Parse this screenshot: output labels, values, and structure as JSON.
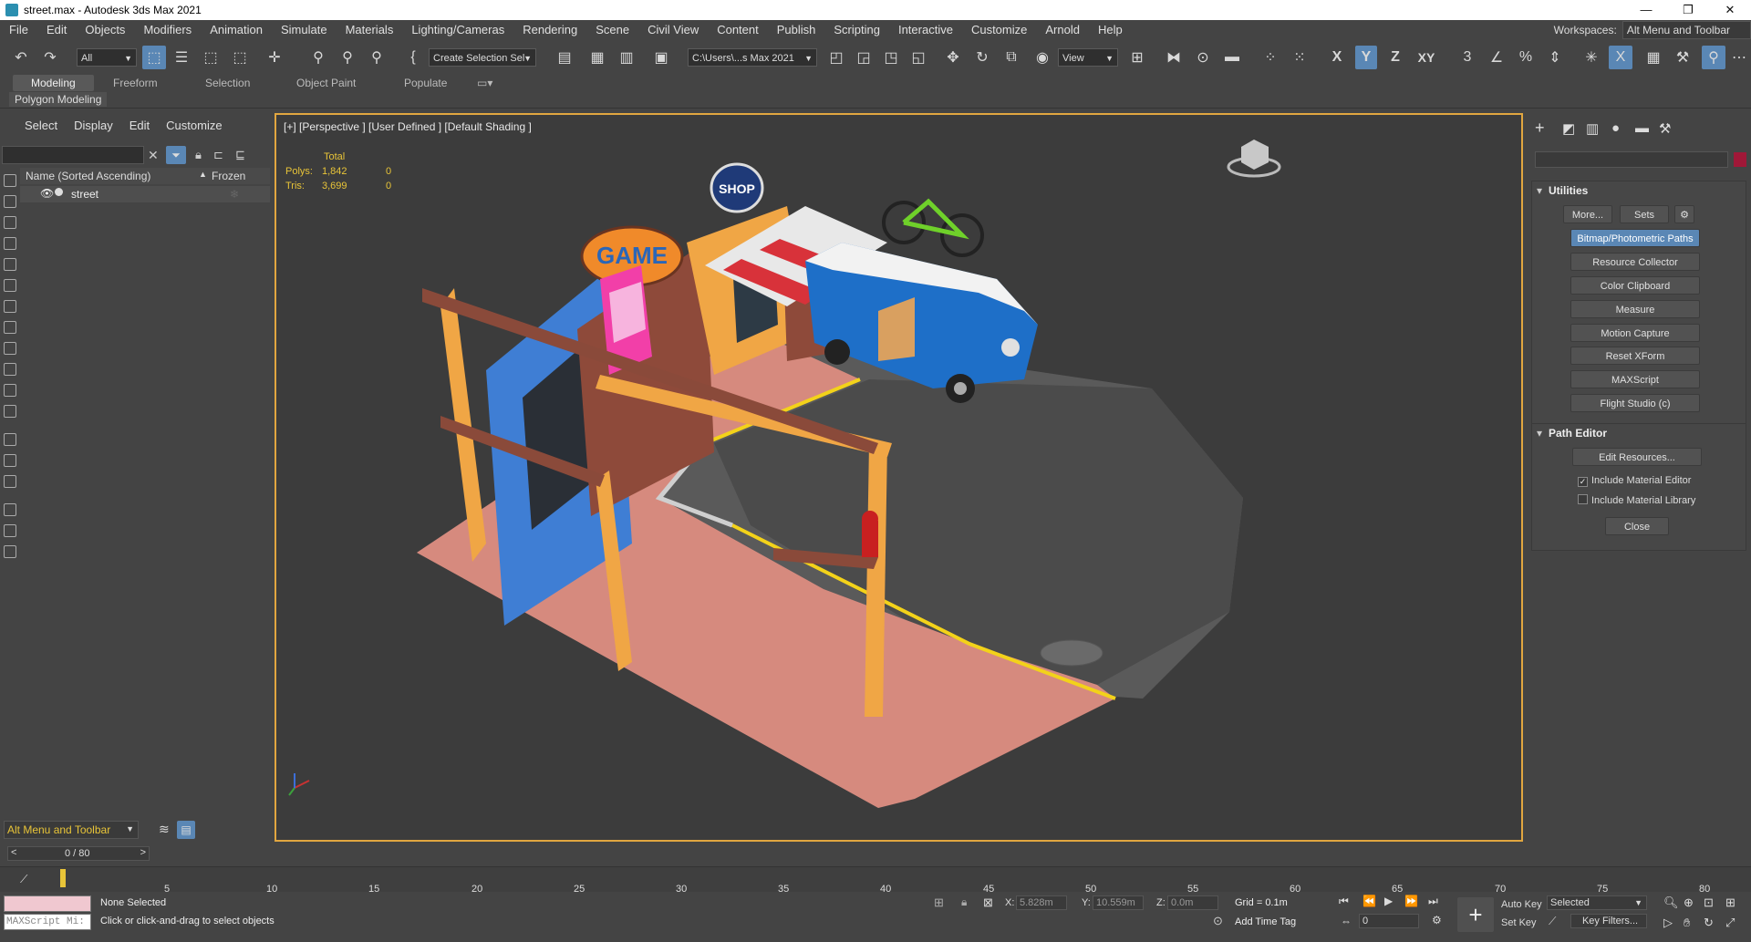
{
  "window": {
    "title": "street.max - Autodesk 3ds Max 2021",
    "min": "—",
    "max": "❐",
    "close": "✕"
  },
  "menu": {
    "items": [
      "File",
      "Edit",
      "Objects",
      "Modifiers",
      "Animation",
      "Simulate",
      "Materials",
      "Lighting/Cameras",
      "Rendering",
      "Scene",
      "Civil View",
      "Content",
      "Publish",
      "Scripting",
      "Interactive",
      "Customize",
      "Arnold",
      "Help"
    ],
    "workspaces_label": "Workspaces:",
    "workspaces_value": "Alt Menu and Toolbar"
  },
  "toolbar": {
    "filter_value": "All",
    "selection_set_value": "Create Selection Sel",
    "path_value": "C:\\Users\\...s Max 2021",
    "view_value": "View",
    "axis_x": "X",
    "axis_y": "Y",
    "axis_z": "Z",
    "axis_xy": "XY"
  },
  "ribbon": {
    "tabs": [
      "Modeling",
      "Freeform",
      "Selection",
      "Object Paint",
      "Populate"
    ],
    "active": "Modeling",
    "subtab": "Polygon Modeling"
  },
  "explorer": {
    "tabs": [
      "Select",
      "Display",
      "Edit",
      "Customize"
    ],
    "col_name": "Name (Sorted Ascending)",
    "col_frozen": "Frozen",
    "sort_glyph": "▲",
    "rows": [
      {
        "name": "street"
      }
    ],
    "layer_value": "Alt Menu and Toolbar"
  },
  "viewport": {
    "label": "[+] [Perspective ] [User Defined ] [Default Shading ]",
    "stats_header": "Total",
    "polys_label": "Polys:",
    "polys_value": "1,842",
    "polys_sel": "0",
    "tris_label": "Tris:",
    "tris_value": "3,699",
    "tris_sel": "0",
    "sign_game": "GAME",
    "sign_shop": "SHOP"
  },
  "command_panel": {
    "utilities_title": "Utilities",
    "more_label": "More...",
    "sets_label": "Sets",
    "utility_buttons": [
      "Bitmap/Photometric Paths",
      "Resource Collector",
      "Color Clipboard",
      "Measure",
      "Motion Capture",
      "Reset XForm",
      "MAXScript",
      "Flight Studio (c)"
    ],
    "active_utility": "Bitmap/Photometric Paths",
    "path_editor_title": "Path Editor",
    "edit_resources_label": "Edit Resources...",
    "include_material_editor": "Include Material Editor",
    "include_material_editor_checked": true,
    "include_material_library": "Include Material Library",
    "include_material_library_checked": false,
    "close_label": "Close"
  },
  "time": {
    "frame_display": "0 / 80",
    "ticks": [
      "5",
      "10",
      "15",
      "20",
      "25",
      "30",
      "35",
      "40",
      "45",
      "50",
      "55",
      "60",
      "65",
      "70",
      "75",
      "80"
    ]
  },
  "status": {
    "maxscript_placeholder": "MAXScript Mi:",
    "selection_status": "None Selected",
    "prompt": "Click or click-and-drag to select objects",
    "x_label": "X:",
    "x_value": "5.828m",
    "y_label": "Y:",
    "y_value": "10.559m",
    "z_label": "Z:",
    "z_value": "0.0m",
    "grid": "Grid = 0.1m",
    "add_time_tag": "Add Time Tag",
    "auto_key": "Auto Key",
    "set_key": "Set Key",
    "selected_value": "Selected",
    "key_filters": "Key Filters...",
    "frame_value": "0"
  }
}
